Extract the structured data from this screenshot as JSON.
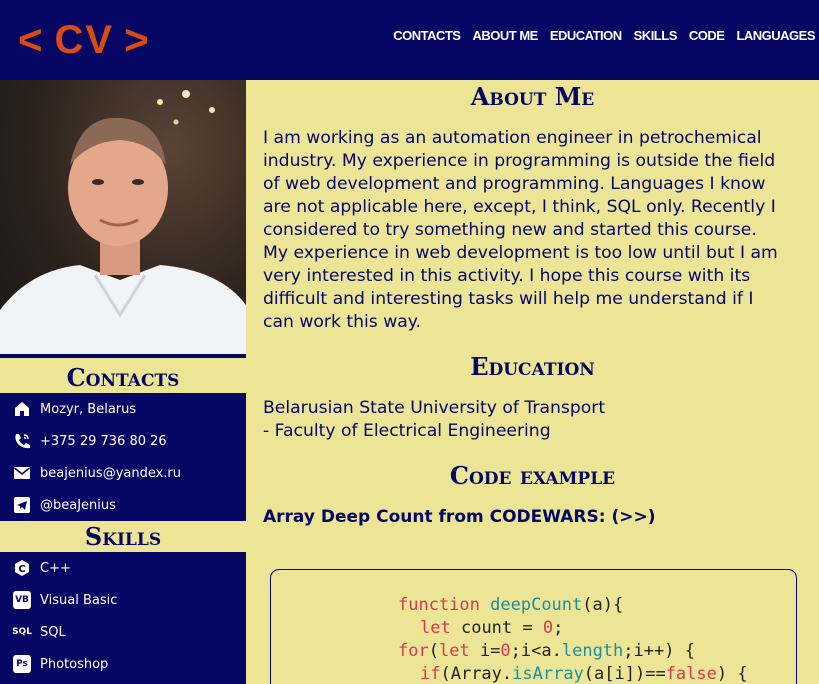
{
  "logo": {
    "left": "<",
    "text": "CV",
    "right": ">"
  },
  "nav": [
    "CONTACTS",
    "ABOUT ME",
    "EDUCATION",
    "SKILLS",
    "CODE",
    "LANGUAGES"
  ],
  "sidebar": {
    "contacts_title": "Contacts",
    "contacts": [
      {
        "icon": "home-icon",
        "text": "Mozyr, Belarus"
      },
      {
        "icon": "phone-icon",
        "text": "+375 29 736 80 26"
      },
      {
        "icon": "mail-icon",
        "text": "beajenius@yandex.ru"
      },
      {
        "icon": "telegram-icon",
        "text": "@beaJenius"
      }
    ],
    "skills_title": "Skills",
    "skills": [
      {
        "icon": "cpp-icon",
        "badge": "C",
        "text": "C++"
      },
      {
        "icon": "vb-icon",
        "badge": "VB",
        "text": "Visual Basic"
      },
      {
        "icon": "sql-icon",
        "badge": "SQL",
        "text": "SQL"
      },
      {
        "icon": "photoshop-icon",
        "badge": "Ps",
        "text": "Photoshop"
      }
    ]
  },
  "main": {
    "about_title": "About Me",
    "about_lines": [
      "I am working as an automation engineer in petrochemical",
      "industry. My experience in programming is outside the field",
      "of web development and programming. Languages I know",
      "are not applicable here, except, I think, SQL only. Recently I",
      "considered to try something new and started this course.",
      "My experience in web development is too low until but I am",
      "very interested in this activity. I hope this course with its",
      "difficult and interesting tasks will help me understand if I",
      "can work this way."
    ],
    "education_title": "Education",
    "education_lines": [
      "Belarusian State University of Transport",
      "- Faculty of Electrical Engineering"
    ],
    "code_title": "Code example",
    "code_subtitle": "Array Deep Count from CODEWARS: (>>)"
  },
  "colors": {
    "navy": "#060664",
    "sand": "#ede596",
    "accent": "#d94a15"
  }
}
